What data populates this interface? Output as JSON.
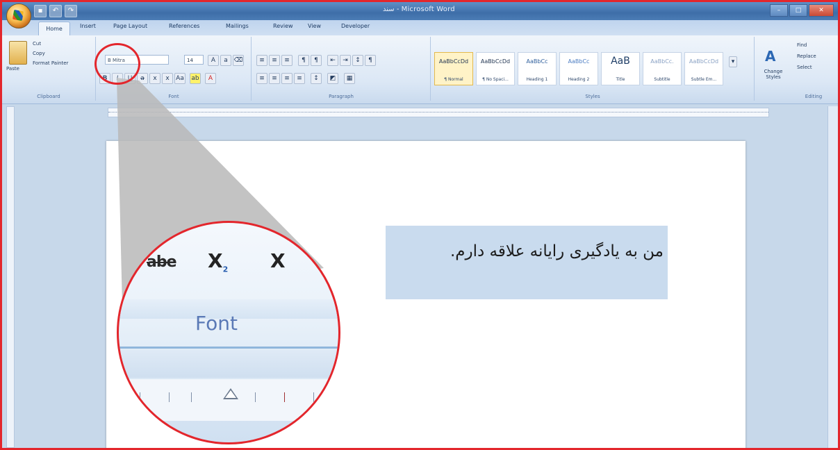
{
  "window": {
    "title": "سند - Microsoft Word",
    "controls": [
      "–",
      "□",
      "✕"
    ]
  },
  "quick_access": [
    "save-icon",
    "undo-icon",
    "redo-icon"
  ],
  "tabs": [
    "Home",
    "Insert",
    "Page Layout",
    "References",
    "Mailings",
    "Review",
    "View",
    "Developer"
  ],
  "ribbon": {
    "clipboard": {
      "paste_label": "Paste",
      "cut_label": "Cut",
      "copy_label": "Copy",
      "format_painter_label": "Format Painter",
      "group_label": "Clipboard"
    },
    "font": {
      "font_name": "B Mitra",
      "font_size": "14",
      "group_label": "Font"
    },
    "paragraph": {
      "group_label": "Paragraph"
    },
    "styles": {
      "items": [
        {
          "sample": "AaBbCcDd",
          "name": "¶ Normal"
        },
        {
          "sample": "AaBbCcDd",
          "name": "¶ No Spaci..."
        },
        {
          "sample": "AaBbCc",
          "name": "Heading 1"
        },
        {
          "sample": "AaBbCc",
          "name": "Heading 2"
        },
        {
          "sample": "AaB",
          "name": "Title"
        },
        {
          "sample": "AaBbCc.",
          "name": "Subtitle"
        },
        {
          "sample": "AaBbCcDd",
          "name": "Subtle Em..."
        }
      ],
      "change_styles_label": "Change Styles",
      "group_label": "Styles"
    },
    "editing": {
      "find_label": "Find",
      "replace_label": "Replace",
      "select_label": "Select",
      "group_label": "Editing"
    }
  },
  "document": {
    "text": "من به یادگیری رایانه علاقه دارم."
  },
  "magnifier": {
    "strikethrough": "abe",
    "subscript_symbol": "X",
    "subscript_index": "2",
    "superscript_symbol": "X",
    "group_label": "Font"
  },
  "colors": {
    "highlight_ring": "#e3262c",
    "selection": "#c9dbee",
    "ribbon": "#dbe7f5"
  }
}
